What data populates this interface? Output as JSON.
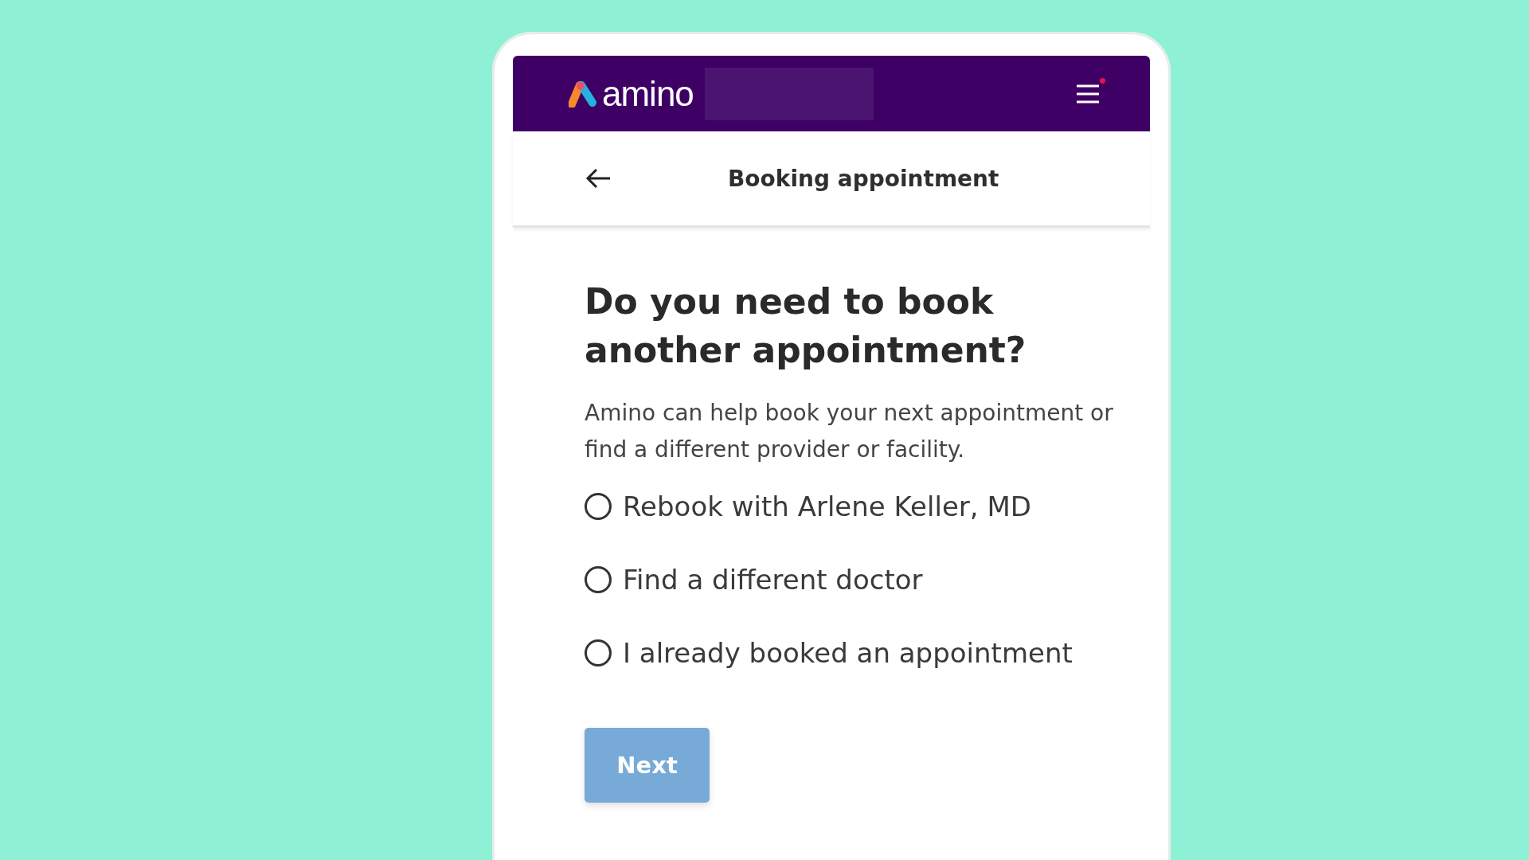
{
  "header": {
    "logo_text": "amino",
    "menu_notification": true
  },
  "nav": {
    "title": "Booking appointment"
  },
  "question": "Do you need to book another appointment?",
  "description": "Amino can help book your next appointment or find a different provider or facility.",
  "options": [
    {
      "label": "Rebook with Arlene Keller, MD",
      "selected": false
    },
    {
      "label": "Find a different doctor",
      "selected": false
    },
    {
      "label": "I already booked an appointment",
      "selected": false
    }
  ],
  "next_button": {
    "label": "Next",
    "disabled": true
  }
}
